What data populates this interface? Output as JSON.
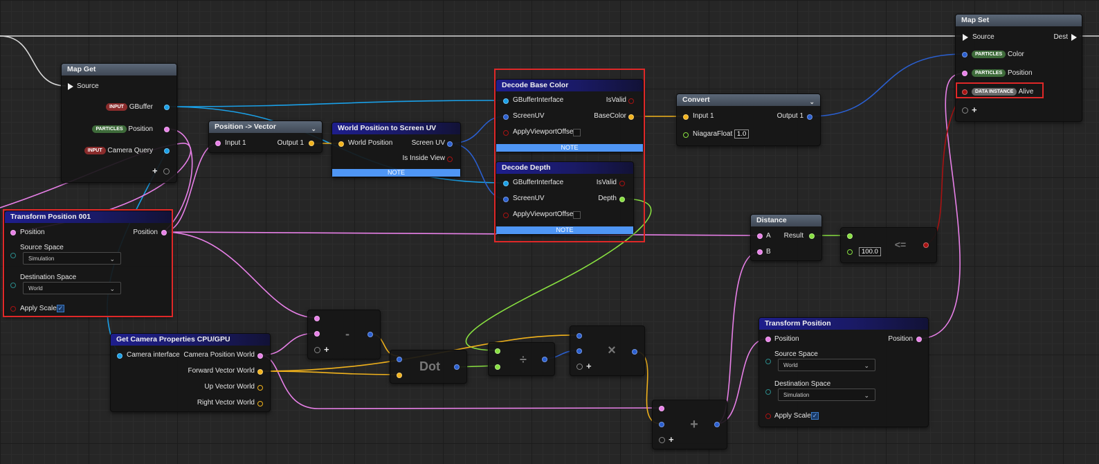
{
  "colors": {
    "exec": "#f0f0f0",
    "position": "#e880e8",
    "interface": "#1aa0e8",
    "vector_blue": "#2a5fd0",
    "float_green": "#88e040",
    "color_yellow": "#f2b31c",
    "bool_red": "#a81212",
    "highlight": "#e02828",
    "note": "#4f96f5"
  },
  "map_get": {
    "title": "Map Get",
    "source": "Source",
    "rows": [
      {
        "badge": "INPUT",
        "label": "GBuffer"
      },
      {
        "badge": "PARTICLES",
        "label": "Position"
      },
      {
        "badge": "INPUT",
        "label": "Camera Query"
      }
    ]
  },
  "transform_position_001": {
    "title": "Transform Position 001",
    "position_in": "Position",
    "position_out": "Position",
    "source_space_label": "Source Space",
    "source_space_value": "Simulation",
    "destination_space_label": "Destination Space",
    "destination_space_value": "World",
    "apply_scale": "Apply Scale"
  },
  "position_to_vector": {
    "title": "Position -> Vector",
    "input": "Input 1",
    "output": "Output 1"
  },
  "world_to_uv": {
    "title": "World Position to Screen UV",
    "input": "World Position",
    "out_uv": "Screen UV",
    "out_inside": "Is Inside View",
    "note": "NOTE"
  },
  "decode_base_color": {
    "title": "Decode Base Color",
    "in1": "GBufferInterface",
    "in2": "ScreenUV",
    "in3": "ApplyViewportOffset",
    "out1": "IsValid",
    "out2": "BaseColor",
    "note": "NOTE"
  },
  "decode_depth": {
    "title": "Decode Depth",
    "in1": "GBufferInterface",
    "in2": "ScreenUV",
    "in3": "ApplyViewportOffset",
    "out1": "IsValid",
    "out2": "Depth",
    "note": "NOTE"
  },
  "convert": {
    "title": "Convert",
    "input": "Input 1",
    "output": "Output 1",
    "niagara_label": "NiagaraFloat",
    "niagara_value": "1.0"
  },
  "map_set": {
    "title": "Map Set",
    "source": "Source",
    "dest": "Dest",
    "rows": [
      {
        "badge": "PARTICLES",
        "label": "Color"
      },
      {
        "badge": "PARTICLES",
        "label": "Position"
      },
      {
        "badge": "DATA INSTANCE",
        "label": "Alive"
      }
    ]
  },
  "distance": {
    "title": "Distance",
    "in_a": "A",
    "in_b": "B",
    "out": "Result"
  },
  "compare": {
    "value": "100.0",
    "op": "<="
  },
  "camera_props": {
    "title": "Get Camera Properties CPU/GPU",
    "input": "Camera interface",
    "out1": "Camera Position World",
    "out2": "Forward Vector World",
    "out3": "Up Vector World",
    "out4": "Right Vector World"
  },
  "ops": {
    "subtract": "-",
    "dot": "Dot",
    "divide": "÷",
    "multiply": "×",
    "add": "+"
  },
  "transform_position": {
    "title": "Transform Position",
    "position_in": "Position",
    "position_out": "Position",
    "source_space_label": "Source Space",
    "source_space_value": "World",
    "destination_space_label": "Destination Space",
    "destination_space_value": "Simulation",
    "apply_scale": "Apply Scale"
  }
}
